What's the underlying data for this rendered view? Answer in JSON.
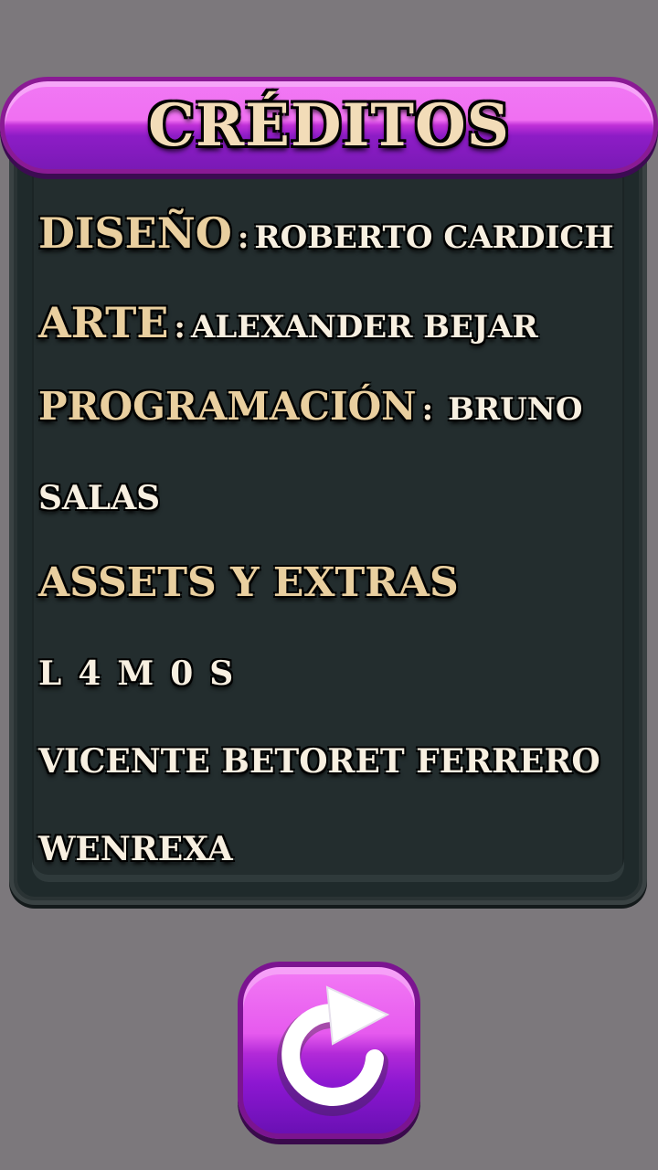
{
  "header": {
    "title": "CRÉDITOS"
  },
  "credits": {
    "design_role": "DISEÑO",
    "design_sep": ":",
    "design_name": "ROBERTO CARDICH",
    "art_role": "ARTE",
    "art_sep": ":",
    "art_name": "ALEXANDER BEJAR",
    "programming_role": "PROGRAMACIÓN",
    "programming_sep": ":",
    "programming_name_line1": "BRUNO",
    "programming_name_line2": "SALAS",
    "assets_role": "ASSETS Y EXTRAS",
    "assets_names": [
      "L4M0S",
      "VICENTE BETORET FERRERO",
      "WENREXA"
    ]
  },
  "replay_button": {
    "icon": "replay-icon"
  },
  "colors": {
    "background": "#7c787c",
    "panel": "#1f2a2b",
    "header_pink": "#f070f2",
    "header_purple": "#8d1cc6",
    "title_text": "#f2dcb8"
  }
}
